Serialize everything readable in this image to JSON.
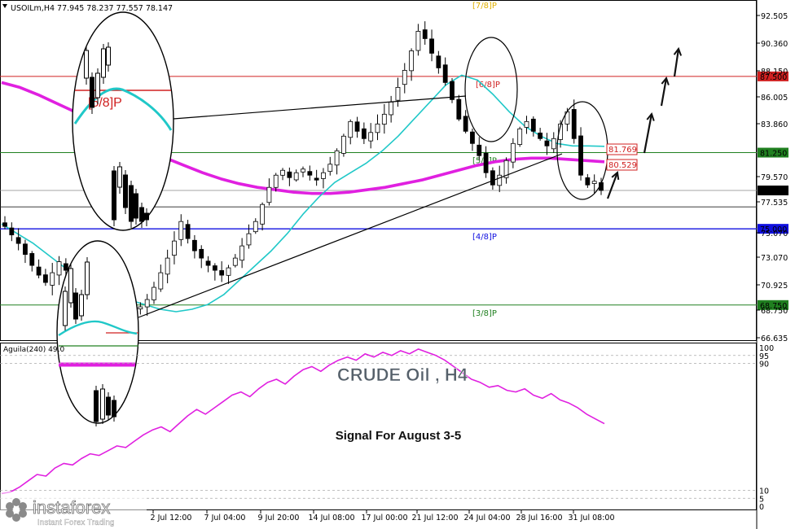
{
  "header": {
    "symbol_line": "USOILm,H4  77.945 78.237 77.557 78.147"
  },
  "price_axis": {
    "ticks": [
      "92.505",
      "90.360",
      "88.150",
      "86.005",
      "83.860",
      "79.570",
      "77.535",
      "75.070",
      "73.070",
      "70.925",
      "68.750",
      "66.635"
    ],
    "current_price": "78.147",
    "current_price_bg": "#000000"
  },
  "levels": [
    {
      "label": "[7/8]P",
      "price": "",
      "value": 92.6,
      "color": "#e0b000"
    },
    {
      "label": "[6/8]P",
      "price": "87.500",
      "value": 87.5,
      "color": "#d02020"
    },
    {
      "label": "[5/8]P",
      "price": "81.250",
      "value": 81.25,
      "color": "#208020"
    },
    {
      "label": "[4/8]P",
      "price": "75.000",
      "value": 75.0,
      "color": "#1010e0"
    },
    {
      "label": "[3/8]P",
      "price": "68.750",
      "value": 68.75,
      "color": "#208020"
    }
  ],
  "annotations": {
    "ma_fast_value": "81.769",
    "ma_slow_value": "80.529",
    "title": "CRUDE Oil ,  H4",
    "signal": "Signal For August 3-5",
    "zoom_label": "[5/8]P"
  },
  "indicator": {
    "name": "Aguila(240) 49.0",
    "ticks": [
      "100",
      "95",
      "90",
      "10",
      "5",
      "0"
    ]
  },
  "time_axis": {
    "labels": [
      "2 Jul 12:00",
      "7 Jul 04:00",
      "9 Jul 20:00",
      "14 Jul 08:00",
      "17 Jul 00:00",
      "21 Jul 12:00",
      "24 Jul 04:00",
      "28 Jul 16:00",
      "31 Jul 08:00"
    ]
  },
  "brand": {
    "name": "instaforex",
    "tagline": "Instant Forex Trading"
  },
  "colors": {
    "ma_slow": "#e020e0",
    "ma_fast": "#20c8c8",
    "indicator": "#e020e0"
  },
  "chart_data": {
    "type": "candlestick",
    "timeframe": "H4",
    "ylim": [
      66.0,
      93.5
    ],
    "x_labels": [
      "2 Jul 12:00",
      "7 Jul 04:00",
      "9 Jul 20:00",
      "14 Jul 08:00",
      "17 Jul 00:00",
      "21 Jul 12:00",
      "24 Jul 04:00",
      "28 Jul 16:00",
      "31 Jul 08:00"
    ],
    "close_path": [
      75.2,
      74.5,
      73.8,
      72.9,
      72.0,
      71.2,
      70.6,
      71.4,
      72.3,
      71.6,
      70.8,
      70.1,
      69.5,
      69.0,
      68.5,
      68.1,
      68.3,
      68.0,
      68.4,
      68.2,
      68.6,
      69.2,
      70.2,
      71.4,
      72.6,
      74.0,
      75.6,
      74.2,
      73.2,
      72.6,
      72.0,
      71.6,
      71.2,
      71.8,
      72.6,
      73.6,
      74.6,
      75.6,
      77.0,
      78.4,
      79.4,
      79.8,
      79.2,
      79.6,
      79.9,
      79.4,
      79.0,
      79.6,
      80.3,
      81.4,
      82.6,
      83.8,
      83.0,
      82.4,
      82.9,
      83.6,
      84.4,
      85.4,
      86.6,
      88.0,
      89.6,
      91.2,
      90.6,
      89.4,
      88.2,
      87.0,
      85.6,
      84.0,
      83.0,
      82.0,
      81.0,
      79.6,
      78.6,
      79.4,
      80.6,
      82.0,
      83.2,
      83.8,
      83.0,
      82.4,
      81.8,
      82.4,
      83.6,
      84.6,
      82.4,
      79.4,
      78.6,
      78.9,
      78.15
    ],
    "ma_slow_path": [
      87.0,
      86.6,
      86.0,
      85.3,
      84.6,
      83.8,
      83.0,
      82.2,
      81.4,
      80.8,
      80.2,
      79.6,
      79.1,
      78.7,
      78.4,
      78.2,
      78.0,
      77.9,
      77.9,
      78.0,
      78.2,
      78.4,
      78.7,
      79.0,
      79.4,
      79.8,
      80.2,
      80.5,
      80.7,
      80.8,
      80.8,
      80.7,
      80.6,
      80.5
    ],
    "ma_fast_path": [
      75.4,
      74.6,
      73.8,
      72.8,
      71.8,
      71.0,
      70.4,
      69.8,
      69.2,
      68.8,
      68.4,
      68.2,
      68.4,
      68.8,
      69.6,
      70.8,
      72.0,
      73.2,
      74.6,
      76.2,
      77.6,
      78.8,
      79.6,
      80.4,
      81.4,
      82.6,
      84.0,
      85.4,
      86.8,
      87.6,
      87.2,
      86.0,
      84.6,
      83.4,
      82.6,
      82.0,
      81.8,
      81.8,
      81.769
    ],
    "indicator_path": [
      8,
      9,
      12,
      16,
      20,
      19,
      24,
      27,
      26,
      30,
      33,
      32,
      35,
      38,
      37,
      41,
      45,
      48,
      50,
      47,
      52,
      57,
      61,
      58,
      62,
      66,
      70,
      72,
      69,
      74,
      78,
      80,
      77,
      82,
      86,
      88,
      85,
      89,
      92,
      94,
      92,
      96,
      94,
      97,
      95,
      98,
      96,
      99,
      97,
      95,
      92,
      88,
      84,
      80,
      78,
      75,
      76,
      73,
      72,
      74,
      70,
      68,
      71,
      67,
      65,
      62,
      58,
      55,
      52
    ],
    "indicator_ylim": [
      0,
      100
    ],
    "levels": [
      92.6,
      87.5,
      81.25,
      75.0,
      68.75
    ],
    "level_labels": [
      "[7/8]P",
      "[6/8]P",
      "[5/8]P",
      "[4/8]P",
      "[3/8]P"
    ]
  }
}
